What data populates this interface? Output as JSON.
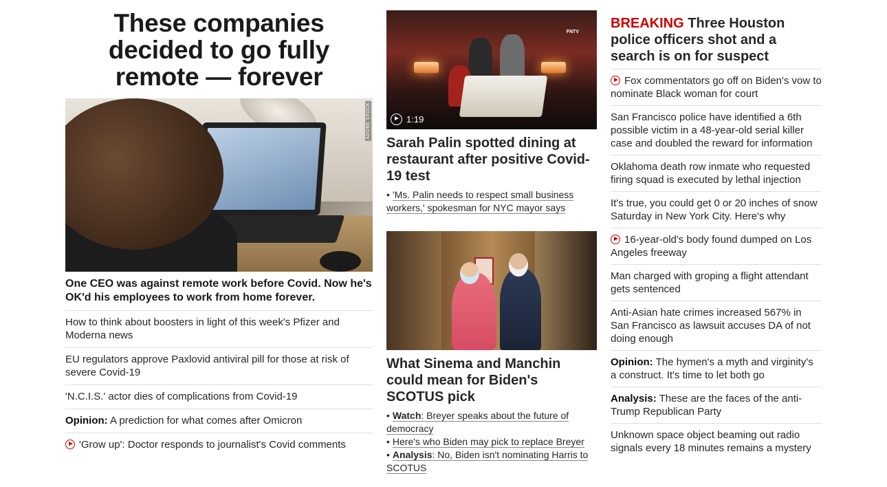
{
  "left": {
    "hero_title": "These companies decided to go fully remote — forever",
    "hero_image_credit": "ADOBE STOCK",
    "hero_caption": "One CEO was against remote work before Covid. Now he's OK'd his employees to work from home forever.",
    "items": [
      {
        "label": "",
        "text": "How to think about boosters in light of this week's Pfizer and Moderna news",
        "video": false
      },
      {
        "label": "",
        "text": "EU regulators approve Paxlovid antiviral pill for those at risk of severe Covid-19",
        "video": false
      },
      {
        "label": "",
        "text": "'N.C.I.S.' actor dies of complications from Covid-19",
        "video": false
      },
      {
        "label": "Opinion:",
        "text": "A prediction for what comes after Omicron",
        "video": false
      },
      {
        "label": "",
        "text": "'Grow up': Doctor responds to journalist's Covid comments",
        "video": true
      }
    ]
  },
  "middle": {
    "story1": {
      "video_duration": "1:19",
      "image_logo": "FNTV",
      "headline": "Sarah Palin spotted dining at restaurant after positive Covid-19 test",
      "bullets": [
        {
          "label": "",
          "text": "'Ms. Palin needs to respect small business workers,' spokesman for NYC mayor says"
        }
      ]
    },
    "story2": {
      "headline": "What Sinema and Manchin could mean for Biden's SCOTUS pick",
      "bullets": [
        {
          "label": "Watch",
          "text": ": Breyer speaks about the future of democracy"
        },
        {
          "label": "",
          "text": "Here's who Biden may pick to replace Breyer"
        },
        {
          "label": "Analysis",
          "text": ": No, Biden isn't nominating Harris to SCOTUS"
        }
      ]
    }
  },
  "right": {
    "breaking_tag": "BREAKING",
    "breaking_headline": " Three Houston police officers shot and a search is on for suspect",
    "items": [
      {
        "label": "",
        "text": "Fox commentators go off on Biden's vow to nominate Black woman for court",
        "video": true
      },
      {
        "label": "",
        "text": "San Francisco police have identified a 6th possible victim in a 48-year-old serial killer case and doubled the reward for information",
        "video": false
      },
      {
        "label": "",
        "text": "Oklahoma death row inmate who requested firing squad is executed by lethal injection",
        "video": false
      },
      {
        "label": "",
        "text": "It's true, you could get 0 or 20 inches of snow Saturday in New York City. Here's why",
        "video": false
      },
      {
        "label": "",
        "text": "16-year-old's body found dumped on Los Angeles freeway",
        "video": true
      },
      {
        "label": "",
        "text": "Man charged with groping a flight attendant gets sentenced",
        "video": false
      },
      {
        "label": "",
        "text": "Anti-Asian hate crimes increased 567% in San Francisco as lawsuit accuses DA of not doing enough",
        "video": false
      },
      {
        "label": "Opinion:",
        "text": "The hymen's a myth and virginity's a construct. It's time to let both go",
        "video": false
      },
      {
        "label": "Analysis:",
        "text": "These are the faces of the anti-Trump Republican Party",
        "video": false
      },
      {
        "label": "",
        "text": "Unknown space object beaming out radio signals every 18 minutes remains a mystery",
        "video": false
      }
    ]
  },
  "colors": {
    "accent_red": "#cc0000",
    "text": "#262626",
    "divider": "#dedede"
  }
}
